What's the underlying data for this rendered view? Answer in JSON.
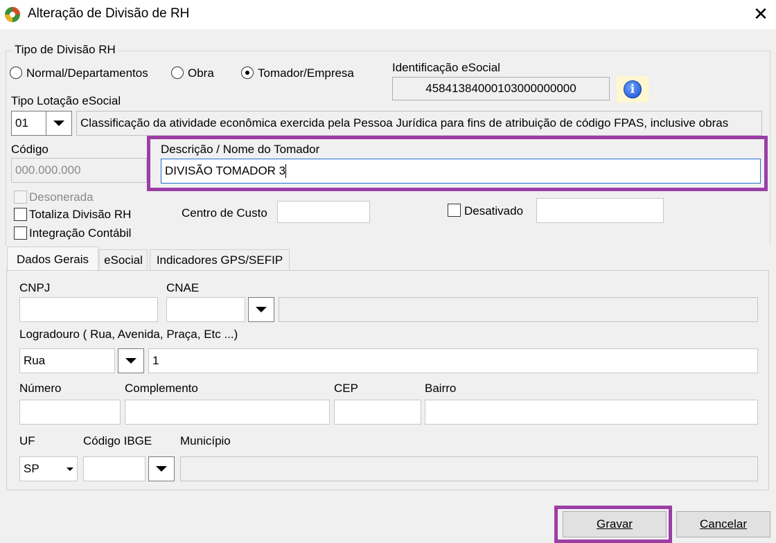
{
  "window": {
    "title": "Alteração de Divisão de RH",
    "close_glyph": "✕"
  },
  "tipo_divisao": {
    "legend": "Tipo de Divisão RH",
    "options": [
      {
        "label": "Normal/Departamentos",
        "checked": false
      },
      {
        "label": "Obra",
        "checked": false
      },
      {
        "label": "Tomador/Empresa",
        "checked": true
      }
    ]
  },
  "esocial_id": {
    "label": "Identificação eSocial",
    "value": "45841384000103000000000",
    "info_icon": "info-icon"
  },
  "tipo_lotacao": {
    "label": "Tipo Lotação eSocial",
    "code": "01",
    "description": "Classificação da atividade econômica exercida pela Pessoa Jurídica para fins de atribuição de código FPAS, inclusive obras"
  },
  "codigo": {
    "label": "Código",
    "placeholder": "000.000.000"
  },
  "descricao": {
    "label": "Descrição / Nome do Tomador",
    "value": "DIVISÃO TOMADOR 3"
  },
  "checks": {
    "desonerada": "Desonerada",
    "totaliza": "Totaliza Divisão RH",
    "integracao": "Integração Contábil",
    "desativado": "Desativado"
  },
  "centro_custo": {
    "label": "Centro de Custo",
    "value": ""
  },
  "tabs": [
    {
      "label": "Dados Gerais",
      "active": true
    },
    {
      "label": "eSocial",
      "active": false
    },
    {
      "label": "Indicadores GPS/SEFIP",
      "active": false
    }
  ],
  "dados_gerais": {
    "cnpj_label": "CNPJ",
    "cnae_label": "CNAE",
    "logradouro_label": "Logradouro ( Rua, Avenida, Praça, Etc ...)",
    "logradouro_tipo": "Rua",
    "logradouro_valor": "1",
    "numero_label": "Número",
    "complemento_label": "Complemento",
    "cep_label": "CEP",
    "bairro_label": "Bairro",
    "uf_label": "UF",
    "uf_value": "SP",
    "ibge_label": "Código IBGE",
    "municipio_label": "Município"
  },
  "buttons": {
    "gravar": "Gravar",
    "cancelar": "Cancelar"
  },
  "colors": {
    "highlight": "#9b3ea6",
    "window_bg": "#f0f0f0"
  }
}
